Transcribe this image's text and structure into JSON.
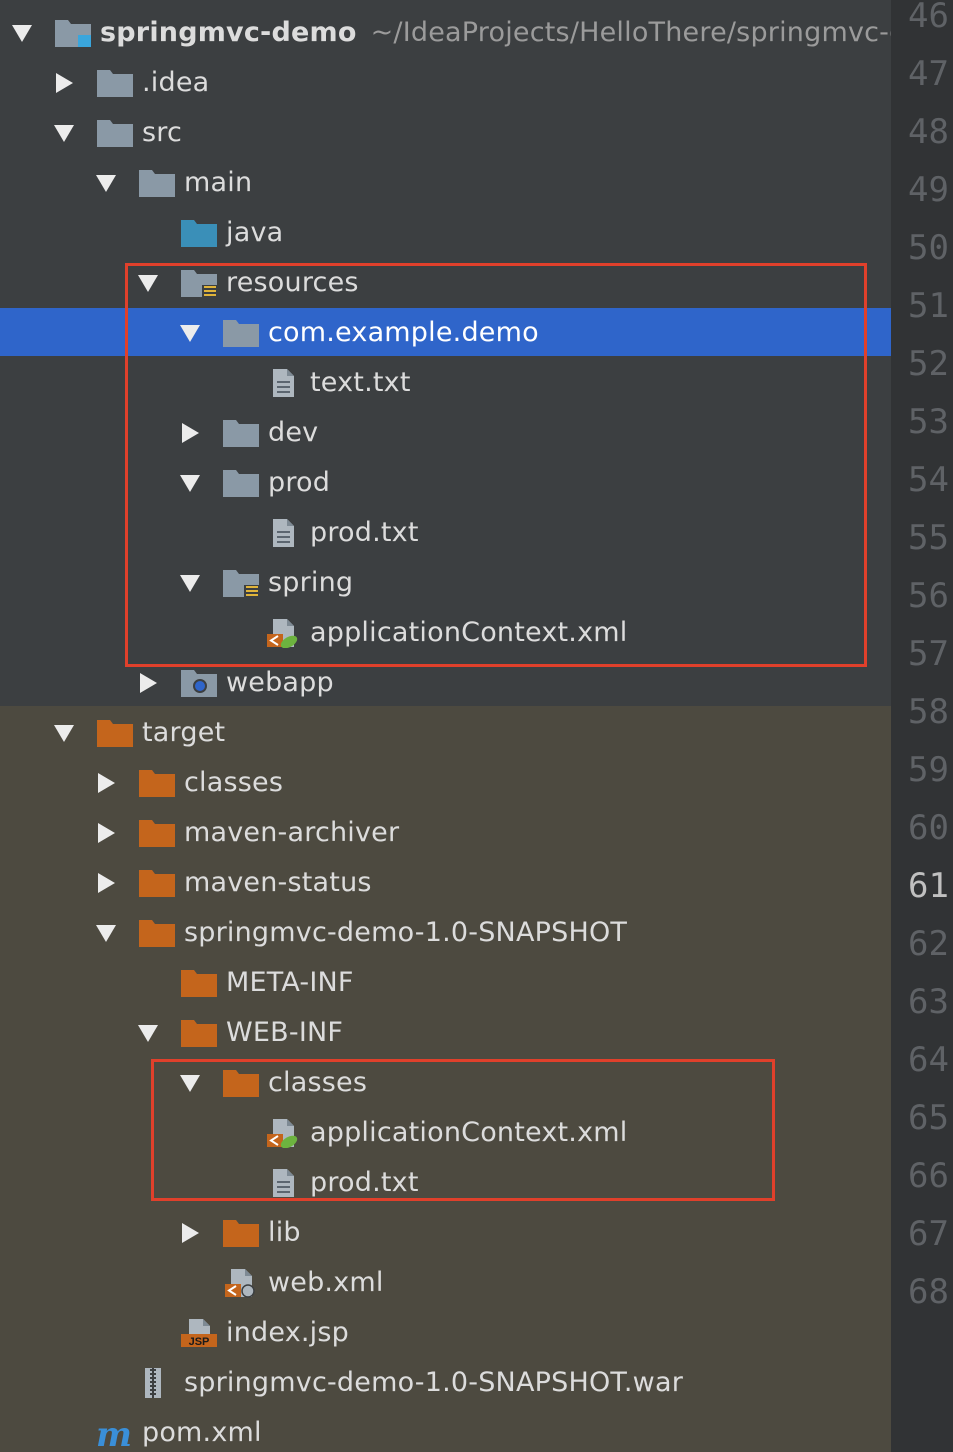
{
  "project": {
    "name": "springmvc-demo",
    "path": "~/IdeaProjects/HelloThere/springmvc-d"
  },
  "tree": [
    {
      "label": "springmvc-demo",
      "depth": 0,
      "arrow": "down",
      "icon": "module-folder-icon"
    },
    {
      "label": ".idea",
      "depth": 1,
      "arrow": "right",
      "icon": "folder-icon"
    },
    {
      "label": "src",
      "depth": 1,
      "arrow": "down",
      "icon": "folder-icon"
    },
    {
      "label": "main",
      "depth": 2,
      "arrow": "down",
      "icon": "folder-icon"
    },
    {
      "label": "java",
      "depth": 3,
      "arrow": "none",
      "icon": "source-folder-icon"
    },
    {
      "label": "resources",
      "depth": 3,
      "arrow": "down",
      "icon": "resources-folder-icon"
    },
    {
      "label": "com.example.demo",
      "depth": 4,
      "arrow": "down",
      "icon": "package-folder-icon",
      "selected": true
    },
    {
      "label": "text.txt",
      "depth": 5,
      "arrow": "none",
      "icon": "text-file-icon"
    },
    {
      "label": "dev",
      "depth": 4,
      "arrow": "right",
      "icon": "folder-icon"
    },
    {
      "label": "prod",
      "depth": 4,
      "arrow": "down",
      "icon": "folder-icon"
    },
    {
      "label": "prod.txt",
      "depth": 5,
      "arrow": "none",
      "icon": "text-file-icon"
    },
    {
      "label": "spring",
      "depth": 4,
      "arrow": "down",
      "icon": "resources-folder-icon"
    },
    {
      "label": "applicationContext.xml",
      "depth": 5,
      "arrow": "none",
      "icon": "spring-xml-file-icon"
    },
    {
      "label": "webapp",
      "depth": 3,
      "arrow": "right",
      "icon": "web-folder-icon"
    },
    {
      "label": "target",
      "depth": 1,
      "arrow": "down",
      "icon": "excluded-folder-icon"
    },
    {
      "label": "classes",
      "depth": 2,
      "arrow": "right",
      "icon": "excluded-folder-icon"
    },
    {
      "label": "maven-archiver",
      "depth": 2,
      "arrow": "right",
      "icon": "excluded-folder-icon"
    },
    {
      "label": "maven-status",
      "depth": 2,
      "arrow": "right",
      "icon": "excluded-folder-icon"
    },
    {
      "label": "springmvc-demo-1.0-SNAPSHOT",
      "depth": 2,
      "arrow": "down",
      "icon": "excluded-folder-icon"
    },
    {
      "label": "META-INF",
      "depth": 3,
      "arrow": "none",
      "icon": "excluded-folder-icon"
    },
    {
      "label": "WEB-INF",
      "depth": 3,
      "arrow": "down",
      "icon": "excluded-folder-icon"
    },
    {
      "label": "classes",
      "depth": 4,
      "arrow": "down",
      "icon": "excluded-folder-icon"
    },
    {
      "label": "applicationContext.xml",
      "depth": 5,
      "arrow": "none",
      "icon": "spring-xml-file-icon"
    },
    {
      "label": "prod.txt",
      "depth": 5,
      "arrow": "none",
      "icon": "text-file-icon"
    },
    {
      "label": "lib",
      "depth": 4,
      "arrow": "right",
      "icon": "excluded-folder-icon"
    },
    {
      "label": "web.xml",
      "depth": 4,
      "arrow": "none",
      "icon": "web-xml-file-icon"
    },
    {
      "label": "index.jsp",
      "depth": 3,
      "arrow": "none",
      "icon": "jsp-file-icon"
    },
    {
      "label": "springmvc-demo-1.0-SNAPSHOT.war",
      "depth": 2,
      "arrow": "none",
      "icon": "war-archive-icon"
    },
    {
      "label": "pom.xml",
      "depth": 1,
      "arrow": "none",
      "icon": "maven-pom-icon"
    }
  ],
  "gutter": {
    "line_numbers": [
      "46",
      "47",
      "48",
      "49",
      "50",
      "51",
      "52",
      "53",
      "54",
      "55",
      "56",
      "57",
      "58",
      "59",
      "60",
      "61",
      "62",
      "63",
      "64",
      "65",
      "66",
      "67",
      "68"
    ],
    "current_line": "61"
  },
  "colors": {
    "highlight_box": "#e0402b",
    "selection": "#2f65ca",
    "excluded_folder": "#c4651c",
    "folder": "#8a99a6"
  }
}
